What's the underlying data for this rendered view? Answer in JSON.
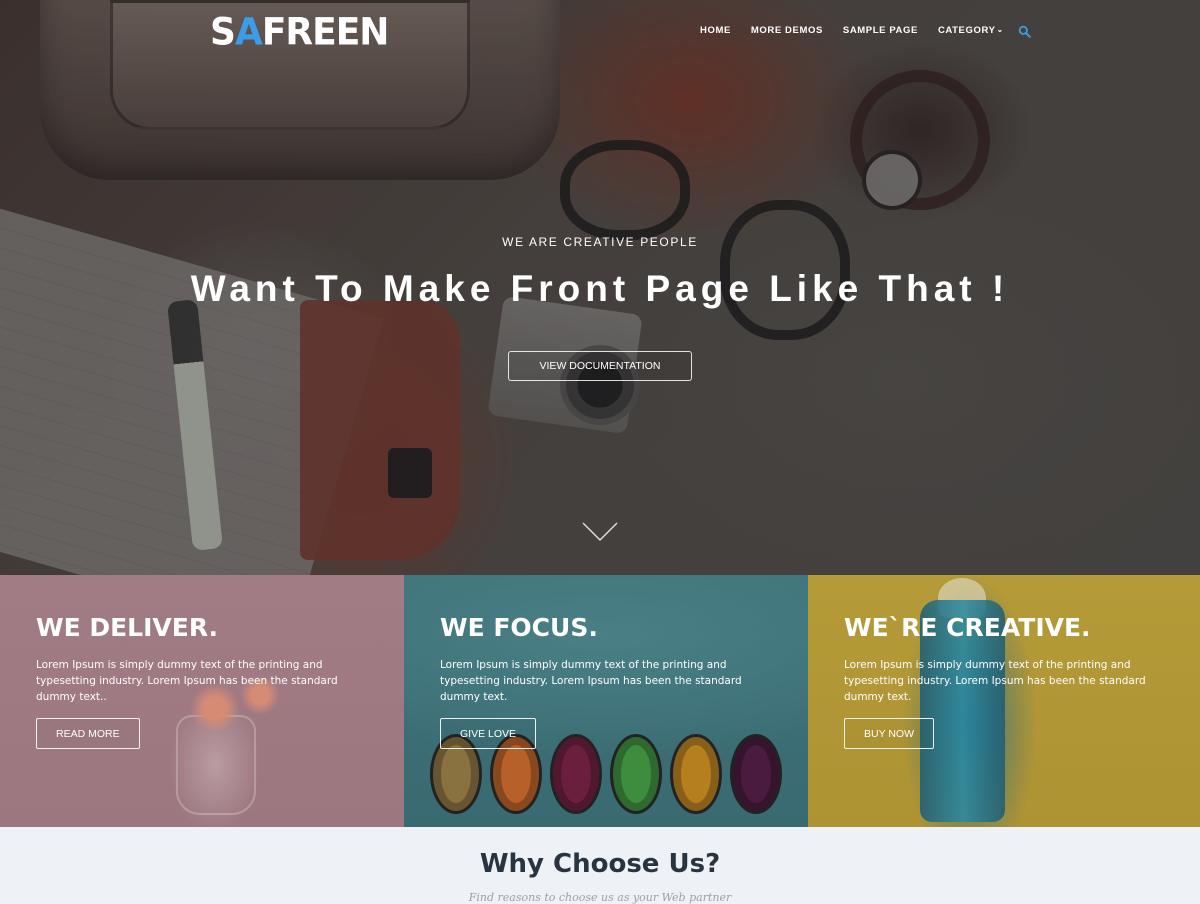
{
  "brand": {
    "logo_main": "SAFREEN",
    "logo_part1": "S",
    "logo_part2": "A",
    "logo_part3": "FREEN",
    "accent_color": "#3b9de8"
  },
  "nav": {
    "items": [
      {
        "label": "HOME"
      },
      {
        "label": "MORE DEMOS"
      },
      {
        "label": "SAMPLE PAGE"
      },
      {
        "label": "CATEGORY",
        "has_dropdown": true
      }
    ],
    "search_icon": "search-icon"
  },
  "hero": {
    "kicker": "WE ARE CREATIVE PEOPLE",
    "title": "Want To Make Front Page Like That !",
    "button_label": "VIEW DOCUMENTATION",
    "scroll_icon": "chevron-down-icon"
  },
  "features": [
    {
      "title": "WE DELIVER.",
      "text": "Lorem Ipsum is simply dummy text of the printing and typesetting industry. Lorem Ipsum has been the standard dummy text..",
      "button_label": "READ MORE",
      "color": "#a27c84"
    },
    {
      "title": "WE FOCUS.",
      "text": "Lorem Ipsum is simply dummy text of the printing and typesetting industry. Lorem Ipsum has been the standard dummy text.",
      "button_label": "GIVE LOVE",
      "color": "#3e737a"
    },
    {
      "title": "WE`RE CREATIVE.",
      "text": "Lorem Ipsum is simply dummy text of the printing and typesetting industry. Lorem Ipsum has been the standard dummy text.",
      "button_label": "BUY NOW",
      "color": "#b59a38"
    }
  ],
  "why": {
    "title": "Why Choose Us?",
    "subtitle": "Find reasons to choose us as your Web partner"
  }
}
